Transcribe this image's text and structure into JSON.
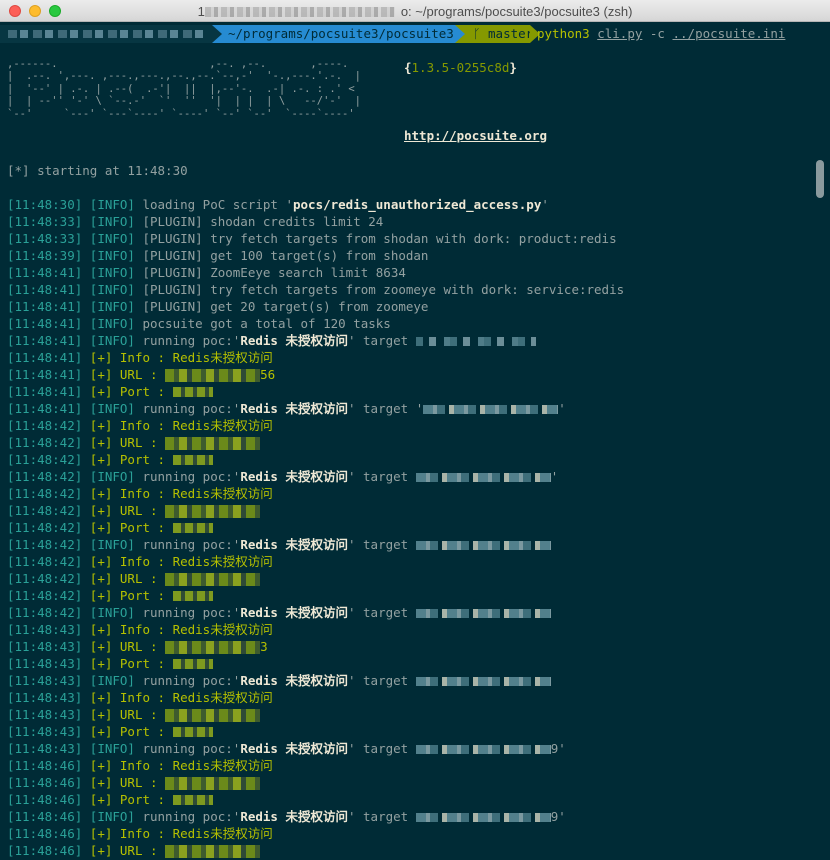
{
  "window": {
    "title_suffix": "o: ~/programs/pocsuite3/pocsuite3 (zsh)",
    "title_prefix": "1"
  },
  "prompt": {
    "dir": "~/programs/pocsuite3/pocsuite3",
    "branch": "master",
    "branch_icon": "git-branch-icon",
    "command": "python3",
    "script": "cli.py",
    "flag": "-c",
    "config": "../pocsuite.ini"
  },
  "banner": {
    "art": ",------.                        ,--. ,--.       ,----.\n|  .--. ',---. ,---.,---.,--.,--.`--,-'  '-.,---.'.-.  |\n|  '--' | .-. | .--(  .-'|  ||  |,--'-.  .-| .-. : .' <\n|  | --'' '-' \\ `--.-'  `'  ''  '|  | |  | \\   --/'-'  |\n`--'     `---' `---`----' `----' `--' `--'  `----`----'",
    "version_open": "{",
    "version": "1.3.5-0255c8d",
    "version_close": "}",
    "url": "http://pocsuite.org"
  },
  "start": "[*] starting at 11:48:30",
  "log": [
    {
      "ts": "[11:48:30]",
      "tag": "[INFO]",
      "text": " loading PoC script '",
      "hl": "pocs/redis_unauthorized_access.py",
      "tail": "'"
    },
    {
      "ts": "[11:48:33]",
      "tag": "[INFO]",
      "text": " [PLUGIN] shodan credits limit 24"
    },
    {
      "ts": "[11:48:33]",
      "tag": "[INFO]",
      "text": " [PLUGIN] try fetch targets from shodan with dork: product:redis"
    },
    {
      "ts": "[11:48:39]",
      "tag": "[INFO]",
      "text": " [PLUGIN] get 100 target(s) from shodan"
    },
    {
      "ts": "[11:48:41]",
      "tag": "[INFO]",
      "text": " [PLUGIN] ZoomEeye search limit 8634"
    },
    {
      "ts": "[11:48:41]",
      "tag": "[INFO]",
      "text": " [PLUGIN] try fetch targets from zoomeye with dork: service:redis"
    },
    {
      "ts": "[11:48:41]",
      "tag": "[INFO]",
      "text": " [PLUGIN] get 20 target(s) from zoomeye"
    },
    {
      "ts": "[11:48:41]",
      "tag": "[INFO]",
      "text": " pocsuite got a total of 120 tasks"
    },
    {
      "ts": "[11:48:41]",
      "tag": "[INFO]",
      "text": " running poc:'",
      "hl": "Redis 未授权访问",
      "tail": "' target ",
      "blur": "a"
    },
    {
      "ts": "[11:48:41]",
      "tag": "[+]",
      "ok": " Info : Redis未授权访问"
    },
    {
      "ts": "[11:48:41]",
      "tag": "[+]",
      "ok": " URL : ",
      "blur": "g",
      "after": "56"
    },
    {
      "ts": "[11:48:41]",
      "tag": "[+]",
      "ok": " Port : ",
      "blur": "gs"
    },
    {
      "ts": "[11:48:41]",
      "tag": "[INFO]",
      "text": " running poc:'",
      "hl": "Redis 未授权访问",
      "tail": "' target '",
      "blur": "b",
      "after": "'"
    },
    {
      "ts": "[11:48:42]",
      "tag": "[+]",
      "ok": " Info : Redis未授权访问"
    },
    {
      "ts": "[11:48:42]",
      "tag": "[+]",
      "ok": " URL : ",
      "blur": "g"
    },
    {
      "ts": "[11:48:42]",
      "tag": "[+]",
      "ok": " Port : ",
      "blur": "gs"
    },
    {
      "ts": "[11:48:42]",
      "tag": "[INFO]",
      "text": " running poc:'",
      "hl": "Redis 未授权访问",
      "tail": "' target ",
      "blur": "b",
      "after": "'"
    },
    {
      "ts": "[11:48:42]",
      "tag": "[+]",
      "ok": " Info : Redis未授权访问"
    },
    {
      "ts": "[11:48:42]",
      "tag": "[+]",
      "ok": " URL : ",
      "blur": "g"
    },
    {
      "ts": "[11:48:42]",
      "tag": "[+]",
      "ok": " Port : ",
      "blur": "gs"
    },
    {
      "ts": "[11:48:42]",
      "tag": "[INFO]",
      "text": " running poc:'",
      "hl": "Redis 未授权访问",
      "tail": "' target ",
      "blur": "b"
    },
    {
      "ts": "[11:48:42]",
      "tag": "[+]",
      "ok": " Info : Redis未授权访问"
    },
    {
      "ts": "[11:48:42]",
      "tag": "[+]",
      "ok": " URL : ",
      "blur": "g"
    },
    {
      "ts": "[11:48:42]",
      "tag": "[+]",
      "ok": " Port : ",
      "blur": "gs"
    },
    {
      "ts": "[11:48:42]",
      "tag": "[INFO]",
      "text": " running poc:'",
      "hl": "Redis 未授权访问",
      "tail": "' target ",
      "blur": "b"
    },
    {
      "ts": "[11:48:43]",
      "tag": "[+]",
      "ok": " Info : Redis未授权访问"
    },
    {
      "ts": "[11:48:43]",
      "tag": "[+]",
      "ok": " URL : ",
      "blur": "g",
      "after": "3"
    },
    {
      "ts": "[11:48:43]",
      "tag": "[+]",
      "ok": " Port : ",
      "blur": "gs"
    },
    {
      "ts": "[11:48:43]",
      "tag": "[INFO]",
      "text": " running poc:'",
      "hl": "Redis 未授权访问",
      "tail": "' target ",
      "blur": "b"
    },
    {
      "ts": "[11:48:43]",
      "tag": "[+]",
      "ok": " Info : Redis未授权访问"
    },
    {
      "ts": "[11:48:43]",
      "tag": "[+]",
      "ok": " URL : ",
      "blur": "g"
    },
    {
      "ts": "[11:48:43]",
      "tag": "[+]",
      "ok": " Port : ",
      "blur": "gs"
    },
    {
      "ts": "[11:48:43]",
      "tag": "[INFO]",
      "text": " running poc:'",
      "hl": "Redis 未授权访问",
      "tail": "' target ",
      "blur": "b",
      "after": "9'"
    },
    {
      "ts": "[11:48:46]",
      "tag": "[+]",
      "ok": " Info : Redis未授权访问"
    },
    {
      "ts": "[11:48:46]",
      "tag": "[+]",
      "ok": " URL : ",
      "blur": "g"
    },
    {
      "ts": "[11:48:46]",
      "tag": "[+]",
      "ok": " Port : ",
      "blur": "gs"
    },
    {
      "ts": "[11:48:46]",
      "tag": "[INFO]",
      "text": " running poc:'",
      "hl": "Redis 未授权访问",
      "tail": "' target ",
      "blur": "b",
      "after": "9'"
    },
    {
      "ts": "[11:48:46]",
      "tag": "[+]",
      "ok": " Info : Redis未授权访问"
    },
    {
      "ts": "[11:48:46]",
      "tag": "[+]",
      "ok": " URL : ",
      "blur": "g"
    }
  ]
}
